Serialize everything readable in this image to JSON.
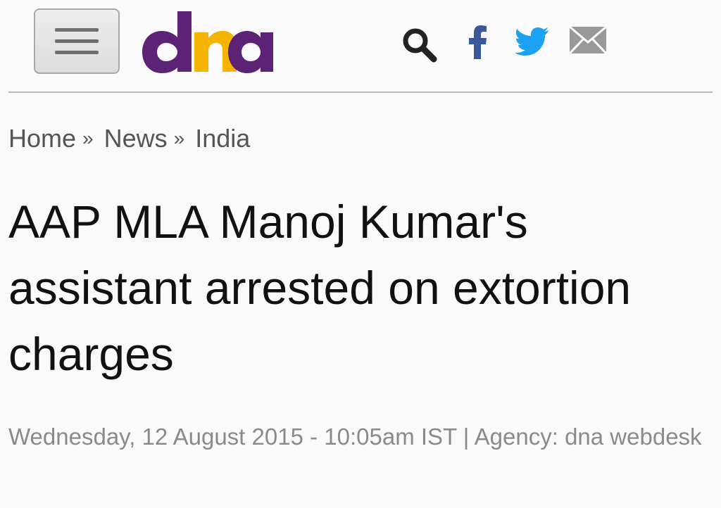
{
  "header": {
    "menu_icon": "hamburger-menu-icon",
    "logo": {
      "text": "dna",
      "colors": {
        "d": "#5b2275",
        "n": "#f4b400",
        "a": "#5b2275"
      }
    },
    "icons": [
      "search-icon",
      "facebook-icon",
      "twitter-icon",
      "mail-icon"
    ],
    "icon_colors": {
      "search": "#222222",
      "facebook": "#3b5998",
      "twitter": "#1da1f2",
      "mail": "#999999"
    }
  },
  "breadcrumb": {
    "items": [
      "Home",
      "News",
      "India"
    ],
    "separator": "»"
  },
  "article": {
    "headline": "AAP MLA Manoj Kumar's assistant arrested on extortion charges",
    "meta": "Wednesday, 12 August 2015 - 10:05am IST | Agency: dna webdesk"
  }
}
